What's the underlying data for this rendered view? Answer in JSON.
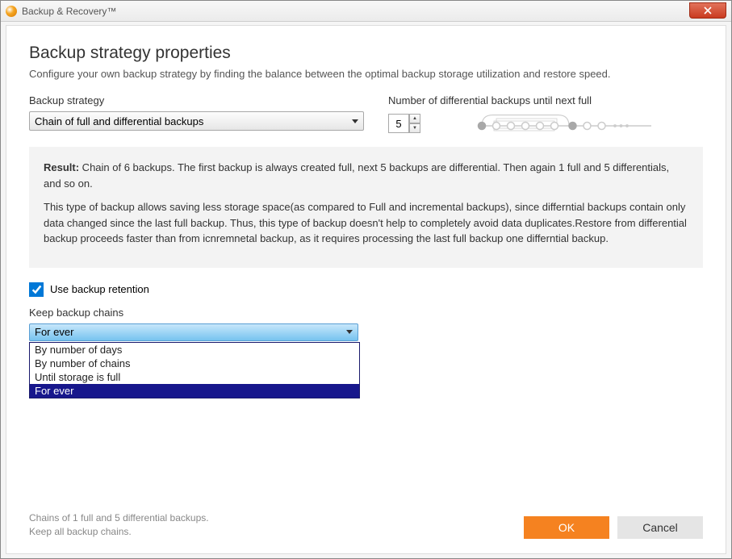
{
  "titlebar": {
    "title": "Backup & Recovery™"
  },
  "heading": "Backup strategy properties",
  "subhead": "Configure your own backup strategy by finding the balance between the optimal backup storage utilization and restore speed.",
  "strategy": {
    "label": "Backup strategy",
    "selected": "Chain of full and differential backups"
  },
  "diff_count": {
    "label": "Number of differential backups until next full",
    "value": "5"
  },
  "result": {
    "label": "Result:",
    "line1": " Chain of 6 backups. The first backup is always created full, next 5 backups are differential. Then again 1 full and 5 differentials, and so on.",
    "line2": "This type of backup allows saving less storage space(as compared to Full and incremental backups), since differntial backups contain only data changed since the last full backup. Thus, this type of backup doesn't help to completely avoid data duplicates.Restore from differential backup proceeds faster than from icnremnetal backup, as it requires processing the last full backup one differntial backup."
  },
  "retention": {
    "checkbox_label": "Use backup retention",
    "keep_label": "Keep backup chains",
    "selected": "For ever",
    "options": [
      "By number of days",
      "By number of chains",
      "Until storage is full",
      "For ever"
    ]
  },
  "footer": {
    "summary_line1": "Chains of 1 full and 5 differential backups.",
    "summary_line2": "Keep all backup chains.",
    "ok": "OK",
    "cancel": "Cancel"
  }
}
